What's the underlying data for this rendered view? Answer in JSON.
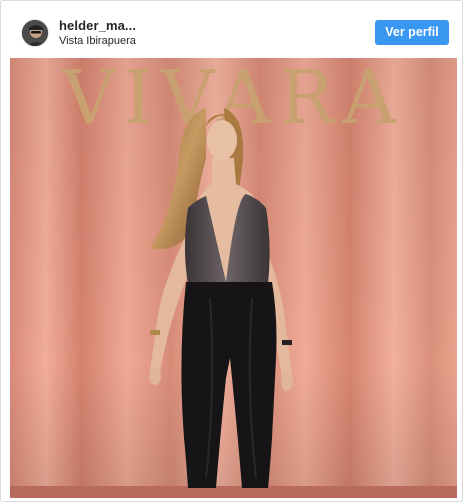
{
  "post": {
    "username": "helder_ma...",
    "location": "Vista Ibirapuera",
    "view_profile_label": "Ver perfil",
    "backdrop_brand": "VIVARA"
  },
  "colors": {
    "button_bg": "#3897f0",
    "curtain": "#e39a86",
    "logo_gold": "#c8a070"
  },
  "icons": {
    "avatar": "profile-avatar"
  }
}
